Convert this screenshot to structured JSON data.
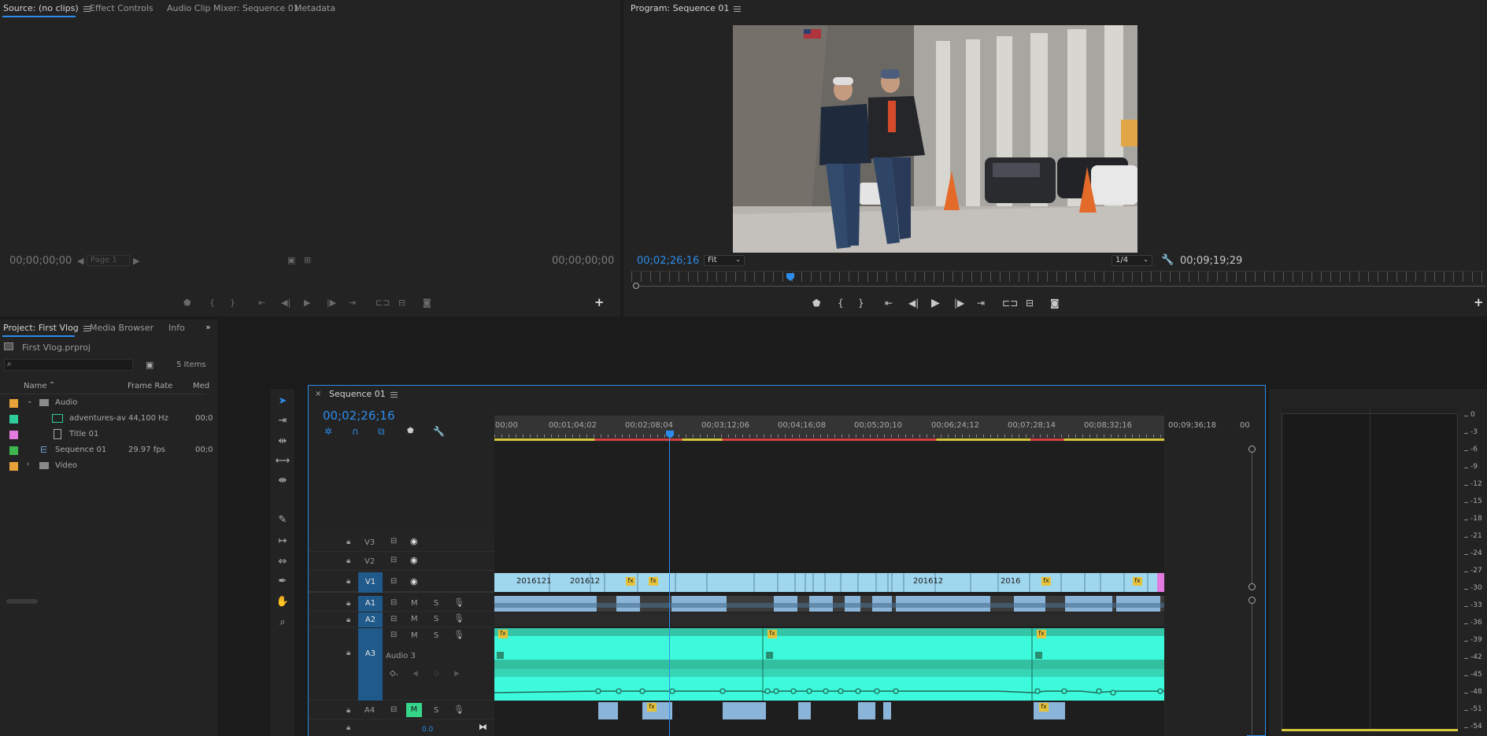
{
  "source": {
    "tabs": [
      "Source: (no clips)",
      "Effect Controls",
      "Audio Clip Mixer: Sequence 01",
      "Metadata"
    ],
    "tc_left": "00;00;00;00",
    "tc_right": "00;00;00;00",
    "page": "Page 1"
  },
  "program": {
    "title": "Program: Sequence 01",
    "tc_left": "00;02;26;16",
    "fit": "Fit",
    "quality": "1/4",
    "tc_right": "00;09;19;29"
  },
  "project": {
    "tabs": [
      "Project: First Vlog",
      "Media Browser",
      "Info"
    ],
    "file": "First Vlog.prproj",
    "search_placeholder": "",
    "items_count": "5 Items",
    "columns": [
      "Name",
      "Frame Rate",
      "Med"
    ],
    "rows": [
      {
        "name": "Audio",
        "rate": "",
        "med": "",
        "color": "#e8a23a"
      },
      {
        "name": "adventures-av",
        "rate": "44,100 Hz",
        "med": "00;0",
        "color": "#2ecc9a"
      },
      {
        "name": "Title 01",
        "rate": "",
        "med": "",
        "color": "#e37adf"
      },
      {
        "name": "Sequence 01",
        "rate": "29.97 fps",
        "med": "00;0",
        "color": "#3cb64f"
      },
      {
        "name": "Video",
        "rate": "",
        "med": "",
        "color": "#e8a23a"
      }
    ]
  },
  "timeline": {
    "tab": "Sequence 01",
    "tc": "00;02;26;16",
    "ruler": [
      "00;00",
      "00;01;04;02",
      "00;02;08;04",
      "00;03;12;06",
      "00;04;16;08",
      "00;05;20;10",
      "00;06;24;12",
      "00;07;28;14",
      "00;08;32;16",
      "00;09;36;18",
      "00"
    ],
    "tracks": {
      "v3": "V3",
      "v2": "V2",
      "v1": "V1",
      "a1": "A1",
      "a2": "A2",
      "a3": "A3",
      "a4": "A4",
      "audio3": "Audio 3",
      "vol": "0.0",
      "m": "M",
      "s": "S"
    },
    "clip_labels": [
      "2016121",
      "201612",
      "201612",
      "2016"
    ],
    "fx": "fx"
  },
  "meter": {
    "scale": [
      "0",
      "-3",
      "-6",
      "-9",
      "-12",
      "-15",
      "-18",
      "-21",
      "-24",
      "-27",
      "-30",
      "-33",
      "-36",
      "-39",
      "-42",
      "-45",
      "-48",
      "-51",
      "-54"
    ]
  },
  "colors": {
    "accent": "#2d8ceb",
    "video_clip": "#9fd7ef",
    "audio_clip": "#3dfadc",
    "audio_dark": "#2a8f70"
  }
}
